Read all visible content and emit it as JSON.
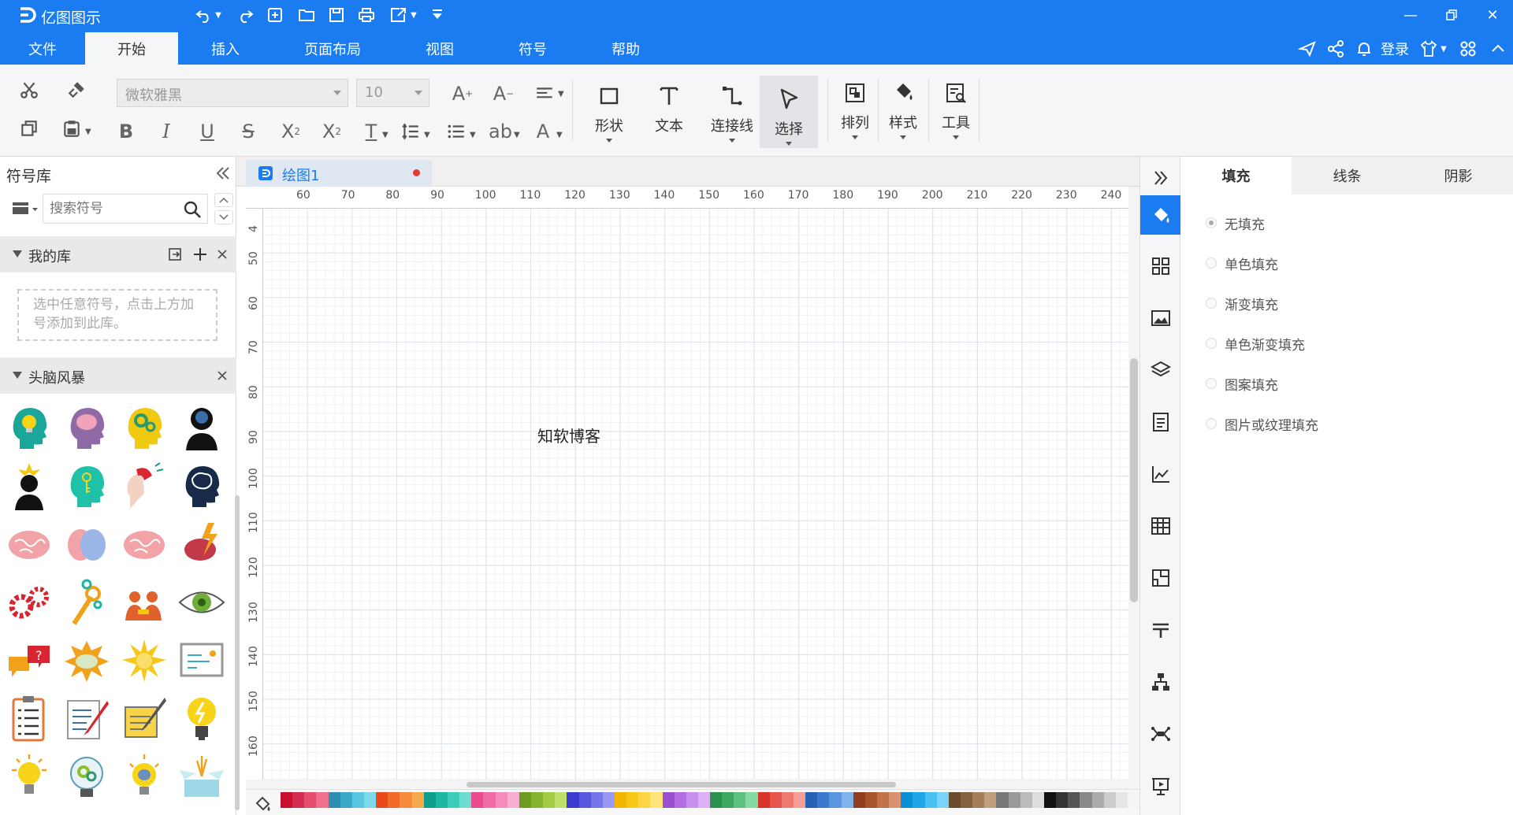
{
  "app": {
    "title": "亿图图示"
  },
  "menu": {
    "tabs": [
      {
        "label": "文件",
        "active": false
      },
      {
        "label": "开始",
        "active": true
      },
      {
        "label": "插入",
        "active": false
      },
      {
        "label": "页面布局",
        "active": false
      },
      {
        "label": "视图",
        "active": false
      },
      {
        "label": "符号",
        "active": false
      },
      {
        "label": "帮助",
        "active": false
      }
    ],
    "login_label": "登录"
  },
  "ribbon": {
    "font_family": "微软雅黑",
    "font_size": "10",
    "big_buttons": [
      {
        "label": "形状",
        "icon": "rectangle-icon"
      },
      {
        "label": "文本",
        "icon": "text-t-icon"
      },
      {
        "label": "连接线",
        "icon": "connector-icon"
      },
      {
        "label": "选择",
        "icon": "select-arrow-icon",
        "active": true
      },
      {
        "label": "排列",
        "icon": "arrange-icon"
      },
      {
        "label": "样式",
        "icon": "paint-bucket-icon"
      },
      {
        "label": "工具",
        "icon": "tools-icon"
      }
    ]
  },
  "left_panel": {
    "title": "符号库",
    "search_placeholder": "搜索符号",
    "my_library": {
      "title": "我的库",
      "hint": "选中任意符号，点击上方加号添加到此库。"
    },
    "brainstorm": {
      "title": "头脑风暴",
      "symbols": [
        "lightbulb-head-icon",
        "brain-head-icon",
        "gear-head-icon",
        "thinking-silhouette-icon",
        "idea-silhouette-icon",
        "key-head-icon",
        "magnet-head-icon",
        "brain-profile-icon",
        "brain-pink-icon",
        "brain-halves-icon",
        "brain-pink-2-icon",
        "brain-lightning-icon",
        "red-gears-icon",
        "wrench-gear-icon",
        "team-meeting-icon",
        "eye-icon",
        "speech-bubble-icon",
        "explosion-cloud-icon",
        "starburst-icon",
        "chalkboard-icon",
        "checklist-icon",
        "writing-paper-icon",
        "notepad-pencil-icon",
        "yellow-lightbulb-icon",
        "glowing-bulb-icon",
        "gear-bulb-icon",
        "brain-bulb-icon",
        "open-box-icon"
      ]
    }
  },
  "document": {
    "tab_label": "绘图1",
    "canvas_text": "知软博客",
    "ruler_top": [
      "60",
      "70",
      "80",
      "90",
      "100",
      "110",
      "120",
      "130",
      "140",
      "150",
      "160",
      "170",
      "180",
      "190",
      "200",
      "210",
      "220",
      "230",
      "240"
    ],
    "ruler_left": [
      "4",
      "50",
      "60",
      "70",
      "80",
      "90",
      "100",
      "110",
      "120",
      "130",
      "140",
      "150",
      "160"
    ]
  },
  "palette": [
    "#c8102e",
    "#d22d4f",
    "#e34d6f",
    "#ef6f8f",
    "#2e8fb3",
    "#3aa9c8",
    "#58c6de",
    "#7ddaeb",
    "#e84a1c",
    "#f06a2a",
    "#f48b3a",
    "#f8a94e",
    "#0e9e8c",
    "#1cb7a4",
    "#3fcbba",
    "#6dddd0",
    "#e94b8d",
    "#ef6ba4",
    "#f48cbb",
    "#f8add1",
    "#6a9c1f",
    "#85b52c",
    "#a2cc44",
    "#c1e06a",
    "#3c3ccf",
    "#5757e0",
    "#7676ec",
    "#9999f4",
    "#f2b700",
    "#f7c81a",
    "#fad646",
    "#fde47c",
    "#9b4fd0",
    "#b26ee0",
    "#c88fec",
    "#dcb1f5",
    "#2b8f4d",
    "#3ba862",
    "#5cc27e",
    "#86d9a0",
    "#d9342b",
    "#e4564b",
    "#ee7a6f",
    "#f4a097",
    "#2660b5",
    "#3a79cf",
    "#5a95e0",
    "#81b2ee",
    "#8f3f1f",
    "#a8552e",
    "#c2724a",
    "#d99170",
    "#0c8fd6",
    "#1fa6e8",
    "#49bff2",
    "#7ad4f7",
    "#6b4a2e",
    "#86613e",
    "#a37e58",
    "#c29f7c",
    "#777777",
    "#999999",
    "#bbbbbb",
    "#dddddd",
    "#111111",
    "#333333",
    "#555555",
    "#888888",
    "#aaaaaa",
    "#cccccc",
    "#e6e6e6",
    "#f4f4f4"
  ],
  "properties": {
    "tabs": [
      {
        "label": "填充",
        "active": true
      },
      {
        "label": "线条",
        "active": false
      },
      {
        "label": "阴影",
        "active": false
      }
    ],
    "fill_options": [
      {
        "label": "无填充",
        "checked": true
      },
      {
        "label": "单色填充",
        "checked": false
      },
      {
        "label": "渐变填充",
        "checked": false
      },
      {
        "label": "单色渐变填充",
        "checked": false
      },
      {
        "label": "图案填充",
        "checked": false
      },
      {
        "label": "图片或纹理填充",
        "checked": false
      }
    ]
  },
  "colors": {
    "accent": "#1a7cf0"
  }
}
